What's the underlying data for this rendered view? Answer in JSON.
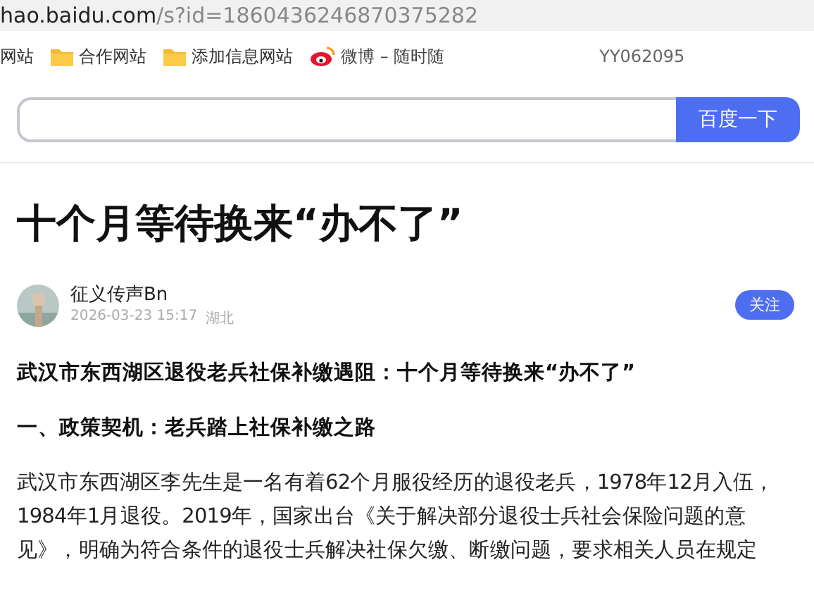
{
  "address_bar": {
    "host": "hao.baidu.com",
    "path": "/s?id=1860436246870375282"
  },
  "bookmarks": [
    {
      "label": "网站",
      "kind": "plain"
    },
    {
      "label": "合作网站",
      "kind": "folder"
    },
    {
      "label": "添加信息网站",
      "kind": "folder"
    },
    {
      "label": "微博 – 随时随",
      "kind": "weibo"
    }
  ],
  "bookmark_extra": "YY062095",
  "search": {
    "button": "百度一下"
  },
  "article": {
    "title": "十个月等待换来“办不了”",
    "author": {
      "name": "征义传声Bn",
      "time": "2026-03-23 15:17",
      "location": "湖北",
      "follow": "关注"
    },
    "lead": "武汉市东西湖区退役老兵社保补缴遇阻：十个月等待换来“办不了”",
    "heading": "一、政策契机：老兵踏上社保补缴之路",
    "body": "武汉市东西湖区李先生是一名有着62个月服役经历的退役老兵，1978年12月入伍，1984年1月退役。2019年，国家出台《关于解决部分退役士兵社会保险问题的意见》，明确为符合条件的退役士兵解决社保欠缴、断缴问题，要求相关人员在规定"
  }
}
